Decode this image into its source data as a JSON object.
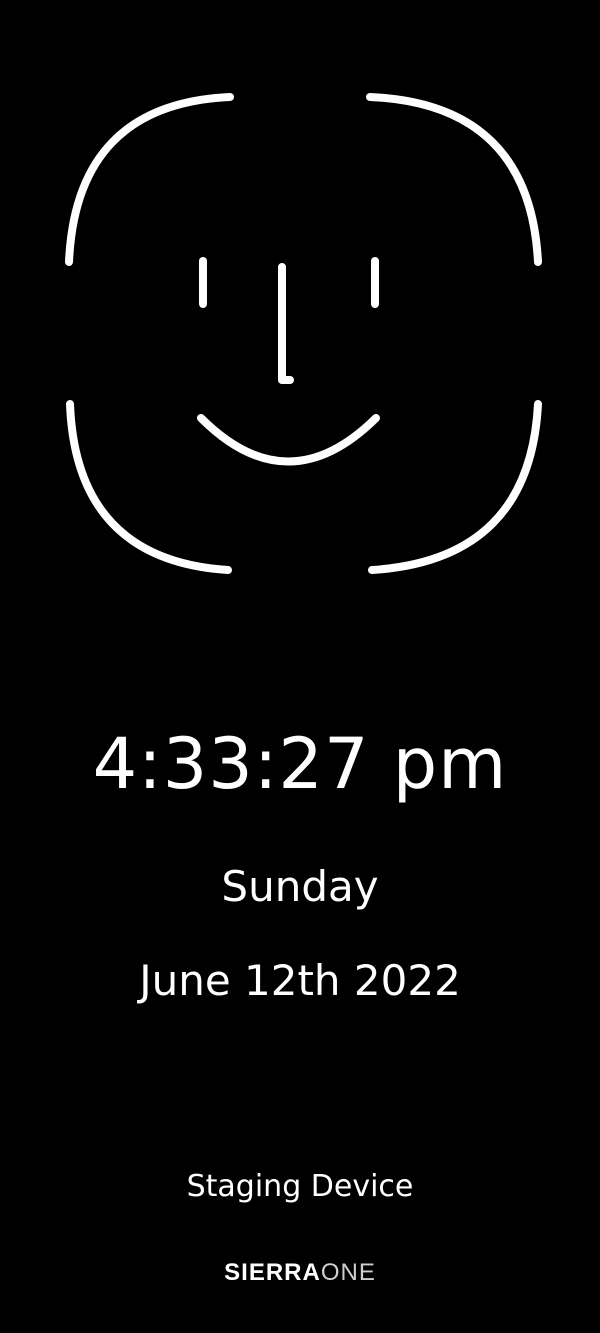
{
  "face_scan": {
    "icon": "face-id-icon",
    "stroke_color": "#ffffff"
  },
  "clock": {
    "time": "4:33:27 pm",
    "day": "Sunday",
    "date": "June 12th 2022"
  },
  "footer": {
    "device_label": "Staging Device",
    "brand_part_1": "SIERRA",
    "brand_part_2": "ONE"
  },
  "colors": {
    "background": "#000000",
    "foreground": "#ffffff"
  }
}
